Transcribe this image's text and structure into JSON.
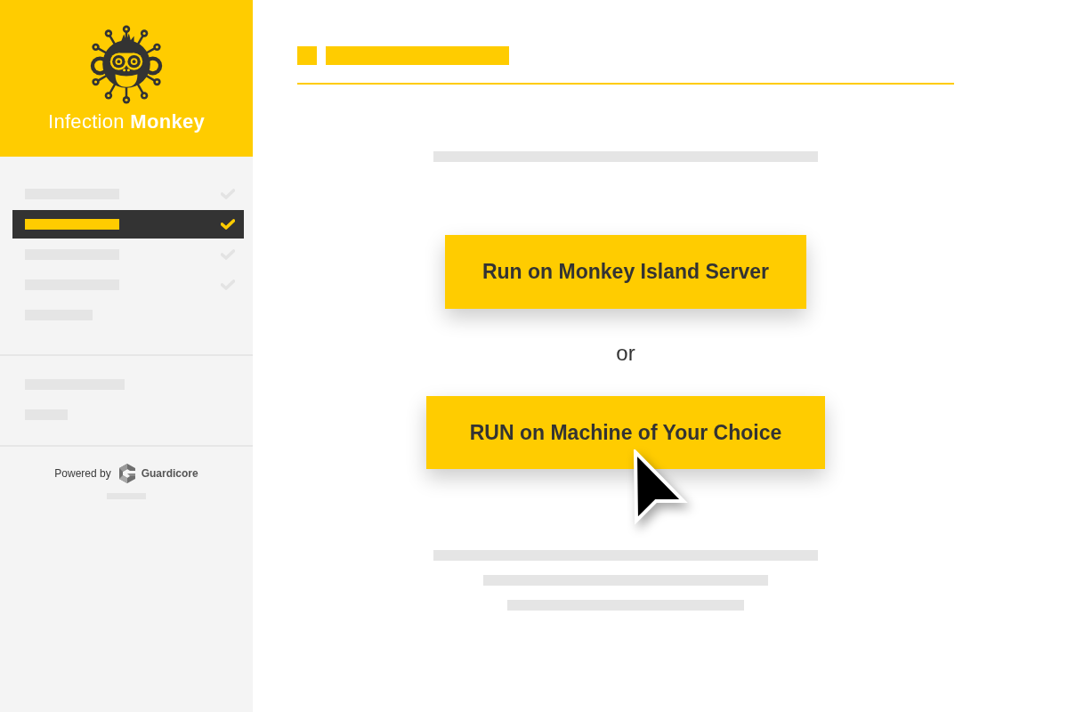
{
  "sidebar": {
    "brand": "Infection **Monkey**",
    "nav_items": [
      {
        "selected": false,
        "checked": true
      },
      {
        "selected": true,
        "checked": true
      },
      {
        "selected": false,
        "checked": true
      },
      {
        "selected": false,
        "checked": true
      },
      {
        "selected": false,
        "checked": false
      }
    ],
    "footer": {
      "powered_by": "Powered by",
      "company": "Guardicore"
    }
  },
  "main": {
    "buttons": [
      {
        "label": "Run on Monkey Island Server"
      },
      {
        "label": "RUN on Machine of Your Choice"
      }
    ],
    "separator": "or"
  }
}
